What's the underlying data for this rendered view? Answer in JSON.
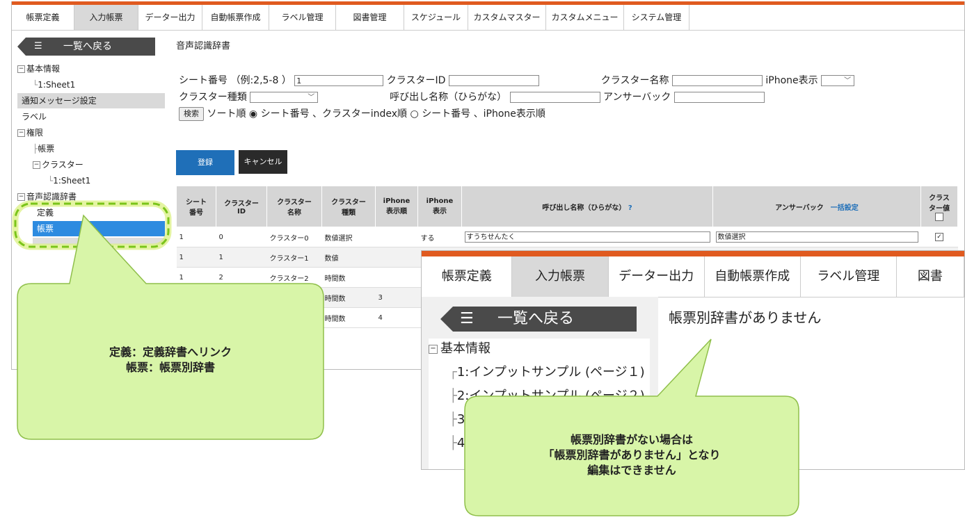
{
  "nav": {
    "tabs": [
      "帳票定義",
      "入力帳票",
      "データー出力",
      "自動帳票作成",
      "ラベル管理",
      "図書管理",
      "スケジュール",
      "カスタムマスター",
      "カスタムメニュー",
      "システム管理"
    ],
    "active_index": 1
  },
  "sidebar": {
    "back_label": "一覧へ戻る",
    "items": [
      {
        "label": "基本情報"
      },
      {
        "label": "1:Sheet1"
      },
      {
        "label": "通知メッセージ設定"
      },
      {
        "label": "ラベル"
      },
      {
        "label": "権限"
      },
      {
        "label": "帳票"
      },
      {
        "label": "クラスター"
      },
      {
        "label": "1:Sheet1"
      },
      {
        "label": "音声認識辞書"
      },
      {
        "label": "定義"
      },
      {
        "label": "帳票"
      }
    ]
  },
  "page": {
    "title": "音声認識辞書"
  },
  "form": {
    "sheet_label": "シート番号 （例:2,5-8 ）",
    "sheet_value": "1",
    "cluster_id_label": "クラスターID",
    "cluster_name_label": "クラスター名称",
    "iphone_display_label": "iPhone表示",
    "cluster_type_label": "クラスター種類",
    "call_name_label": "呼び出し名称（ひらがな）",
    "answer_back_label": "アンサーバック",
    "search_button": "検索",
    "sort_label": "ソート順",
    "sort_option1": "シート番号 、クラスターindex順",
    "sort_option2": "シート番号 、iPhone表示順"
  },
  "buttons": {
    "register": "登録",
    "cancel": "キャンセル"
  },
  "table": {
    "headers": {
      "sheet": [
        "シート",
        "番号"
      ],
      "cluster_id": [
        "クラスター",
        "ID"
      ],
      "cluster_name": [
        "クラスター",
        "名称"
      ],
      "cluster_type": [
        "クラスター",
        "種類"
      ],
      "iphone_order": [
        "iPhone",
        "表示順"
      ],
      "iphone_display": [
        "iPhone",
        "表示"
      ],
      "call_name": "呼び出し名称（ひらがな）",
      "call_name_help": "?",
      "answer_back": "アンサーバック",
      "bulk_setting": "一括設定",
      "cluster_value": [
        "クラス",
        "ター値"
      ]
    },
    "rows": [
      {
        "sheet": "1",
        "id": "0",
        "name": "クラスター0",
        "type": "数値選択",
        "order": "",
        "display": "する",
        "call": "すうちせんたく",
        "answer": "数値選択"
      },
      {
        "sheet": "1",
        "id": "1",
        "name": "クラスター1",
        "type": "数値",
        "order": "",
        "display": "",
        "call": "",
        "answer": ""
      },
      {
        "sheet": "1",
        "id": "2",
        "name": "クラスター2",
        "type": "時間数",
        "order": "",
        "display": "",
        "call": "",
        "answer": ""
      },
      {
        "sheet": "",
        "id": "",
        "name": "",
        "type": "時間数",
        "order": "3",
        "display": "",
        "call": "",
        "answer": ""
      },
      {
        "sheet": "",
        "id": "",
        "name": "",
        "type": "時間数",
        "order": "4",
        "display": "",
        "call": "",
        "answer": ""
      }
    ]
  },
  "zoom": {
    "tabs": [
      "帳票定義",
      "入力帳票",
      "データー出力",
      "自動帳票作成",
      "ラベル管理",
      "図書"
    ],
    "active_index": 1,
    "back_label": "一覧へ戻る",
    "tree": [
      "基本情報",
      "1:インプットサンプル (ページ１)",
      "2:インプットサンプル (ページ２)",
      "3",
      "4"
    ],
    "message": "帳票別辞書がありません"
  },
  "callouts": {
    "left": [
      "定義：定義辞書へリンク",
      "帳票：帳票別辞書"
    ],
    "right": [
      "帳票別辞書がない場合は",
      "「帳票別辞書がありません」となり",
      "編集はできません"
    ]
  },
  "colors": {
    "accent": "#e05a1f",
    "selected": "#2d8be0",
    "register": "#1f6fb8",
    "callout_fill": "#d8f5a8",
    "callout_stroke": "#8fbf4a",
    "highlight_dash": "#7ac41a"
  }
}
